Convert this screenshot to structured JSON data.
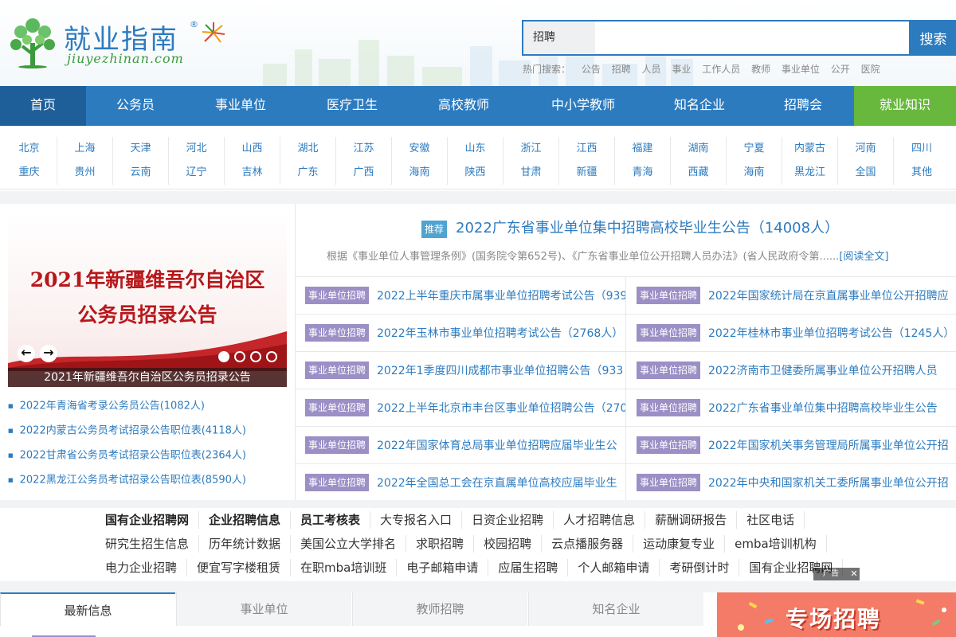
{
  "logo": {
    "title": "就业指南",
    "reg": "®",
    "domain": "jiuyezhinan.com"
  },
  "search": {
    "type": "招聘",
    "placeholder": "",
    "button": "搜索"
  },
  "hot_search": {
    "label": "热门搜索：",
    "items": [
      "公告",
      "招聘",
      "人员",
      "事业",
      "工作人员",
      "教师",
      "事业单位",
      "公开",
      "医院"
    ]
  },
  "nav": [
    "首页",
    "公务员",
    "事业单位",
    "医疗卫生",
    "高校教师",
    "中小学教师",
    "知名企业",
    "招聘会",
    "就业知识"
  ],
  "regions": [
    [
      "北京",
      "上海",
      "天津",
      "河北",
      "山西",
      "湖北",
      "江苏",
      "安徽",
      "山东",
      "浙江",
      "江西",
      "福建",
      "湖南",
      "宁夏",
      "内蒙古",
      "河南",
      "四川"
    ],
    [
      "重庆",
      "贵州",
      "云南",
      "辽宁",
      "吉林",
      "广东",
      "广西",
      "海南",
      "陕西",
      "甘肃",
      "新疆",
      "青海",
      "西藏",
      "海南",
      "黑龙江",
      "全国",
      "其他"
    ]
  ],
  "banner": {
    "line1": "2021年新疆维吾尔自治区",
    "line2": "公务员招录公告",
    "caption": "2021年新疆维吾尔自治区公务员招录公告",
    "prev": "←",
    "next": "→"
  },
  "left_list": [
    "2022年青海省考录公务员公告(1082人)",
    "2022内蒙古公务员考试招录公告职位表(4118人)",
    "2022甘肃省公务员考试招录公告职位表(2364人)",
    "2022黑龙江公务员考试招录公告职位表(8590人)"
  ],
  "feature": {
    "tag": "推荐",
    "title": "2022广东省事业单位集中招聘高校毕业生公告（14008人）",
    "desc": "根据《事业单位人事管理条例》(国务院令第652号)、《广东省事业单位公开招聘人员办法》(省人民政府令第......",
    "read_more": "[阅读全文]"
  },
  "news_tag": "事业单位招聘",
  "news": [
    [
      "2022上半年重庆市属事业单位招聘考试公告（939",
      "2022年国家统计局在京直属事业单位公开招聘应"
    ],
    [
      "2022年玉林市事业单位招聘考试公告（2768人）",
      "2022年桂林市事业单位招聘考试公告（1245人）"
    ],
    [
      "2022年1季度四川成都市事业单位招聘公告（933",
      "2022济南市卫健委所属事业单位公开招聘人员"
    ],
    [
      "2022上半年北京市丰台区事业单位招聘公告（270",
      "2022广东省事业单位集中招聘高校毕业生公告"
    ],
    [
      "2022年国家体育总局事业单位招聘应届毕业生公",
      "2022年国家机关事务管理局所属事业单位公开招"
    ],
    [
      "2022年全国总工会在京直属单位高校应届毕业生",
      "2022年中央和国家机关工委所属事业单位公开招"
    ]
  ],
  "links": [
    [
      {
        "t": "国有企业招聘网",
        "b": true
      },
      {
        "t": "企业招聘信息",
        "b": true
      },
      {
        "t": "员工考核表",
        "b": true
      },
      {
        "t": "大专报名入口",
        "b": false
      },
      {
        "t": "日资企业招聘",
        "b": false
      },
      {
        "t": "人才招聘信息",
        "b": false
      },
      {
        "t": "薪酬调研报告",
        "b": false
      },
      {
        "t": "社区电话",
        "b": false
      }
    ],
    [
      {
        "t": "研究生招生信息",
        "b": false
      },
      {
        "t": "历年统计数据",
        "b": false
      },
      {
        "t": "美国公立大学排名",
        "b": false
      },
      {
        "t": "求职招聘",
        "b": false
      },
      {
        "t": "校园招聘",
        "b": false
      },
      {
        "t": "云点播服务器",
        "b": false
      },
      {
        "t": "运动康复专业",
        "b": false
      },
      {
        "t": "emba培训机构",
        "b": false
      }
    ],
    [
      {
        "t": "电力企业招聘",
        "b": false
      },
      {
        "t": "便宜写字楼租赁",
        "b": false
      },
      {
        "t": "在职mba培训班",
        "b": false
      },
      {
        "t": "电子邮箱申请",
        "b": false
      },
      {
        "t": "应届生招聘",
        "b": false
      },
      {
        "t": "个人邮箱申请",
        "b": false
      },
      {
        "t": "考研倒计时",
        "b": false
      },
      {
        "t": "国有企业招聘网",
        "b": false
      }
    ]
  ],
  "ad": {
    "label": "广告",
    "close": "✕"
  },
  "tabs": [
    "最新信息",
    "事业单位",
    "教师招聘",
    "知名企业"
  ],
  "promo": "专场招聘",
  "colors": {
    "brand_blue": "#2d7bbf",
    "green": "#67b83c",
    "tag_purple": "#9b8fc6",
    "banner_red": "#b7181b"
  }
}
